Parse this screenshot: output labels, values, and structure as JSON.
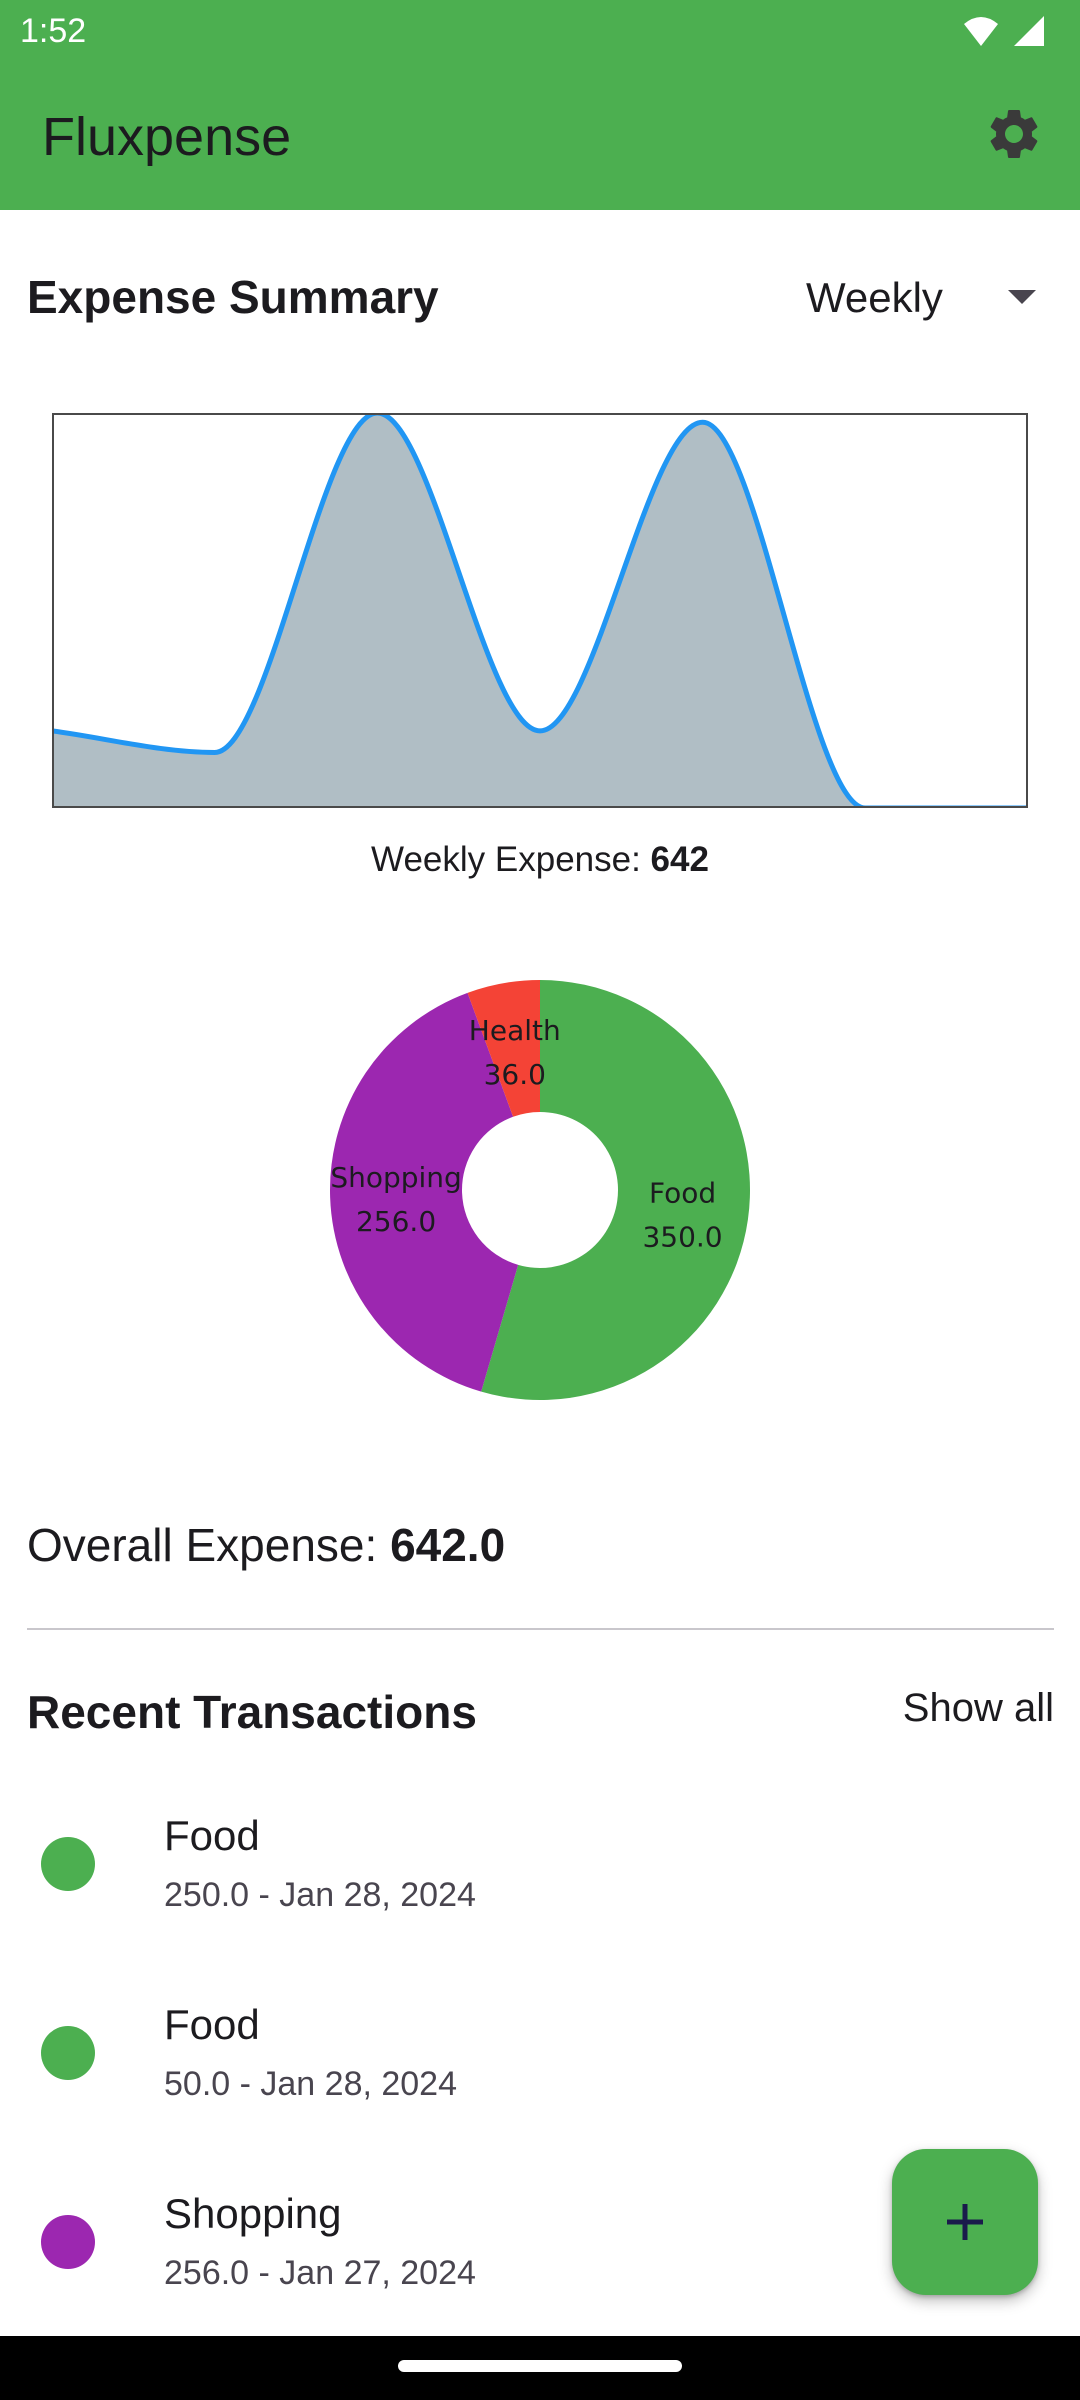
{
  "status_bar": {
    "time": "1:52",
    "icons": [
      "wifi-icon",
      "cell-signal-icon"
    ]
  },
  "app_bar": {
    "title": "Fluxpense",
    "actions": [
      "gear-icon"
    ],
    "background_color": "#4caf50"
  },
  "summary": {
    "title": "Expense Summary",
    "period": "Weekly",
    "weekly_label_prefix": "Weekly Expense: ",
    "weekly_total": "642"
  },
  "chart_data": [
    {
      "type": "area",
      "x": [
        0,
        1,
        2,
        3,
        4,
        5,
        6
      ],
      "values": [
        50,
        36,
        256,
        50,
        250,
        0,
        0
      ],
      "ylim": [
        0,
        256
      ],
      "line_color": "#2196f3",
      "fill_color": "#b0bec5",
      "grid": false
    },
    {
      "type": "pie",
      "categories": [
        "Food",
        "Shopping",
        "Health"
      ],
      "values": [
        350.0,
        256.0,
        36.0
      ],
      "value_labels": [
        "350.0",
        "256.0",
        "36.0"
      ],
      "colors": [
        "#4caf50",
        "#9c27b0",
        "#f44336"
      ],
      "donut": true
    }
  ],
  "overall": {
    "prefix": "Overall Expense: ",
    "value": "642.0"
  },
  "recent": {
    "title": "Recent Transactions",
    "show_all": "Show all",
    "items": [
      {
        "category": "Food",
        "detail": "250.0 - Jan 28, 2024",
        "color": "#4caf50"
      },
      {
        "category": "Food",
        "detail": "50.0 - Jan 28, 2024",
        "color": "#4caf50"
      },
      {
        "category": "Shopping",
        "detail": "256.0 - Jan 27, 2024",
        "color": "#9c27b0"
      }
    ]
  },
  "fab": {
    "icon": "plus-icon"
  }
}
